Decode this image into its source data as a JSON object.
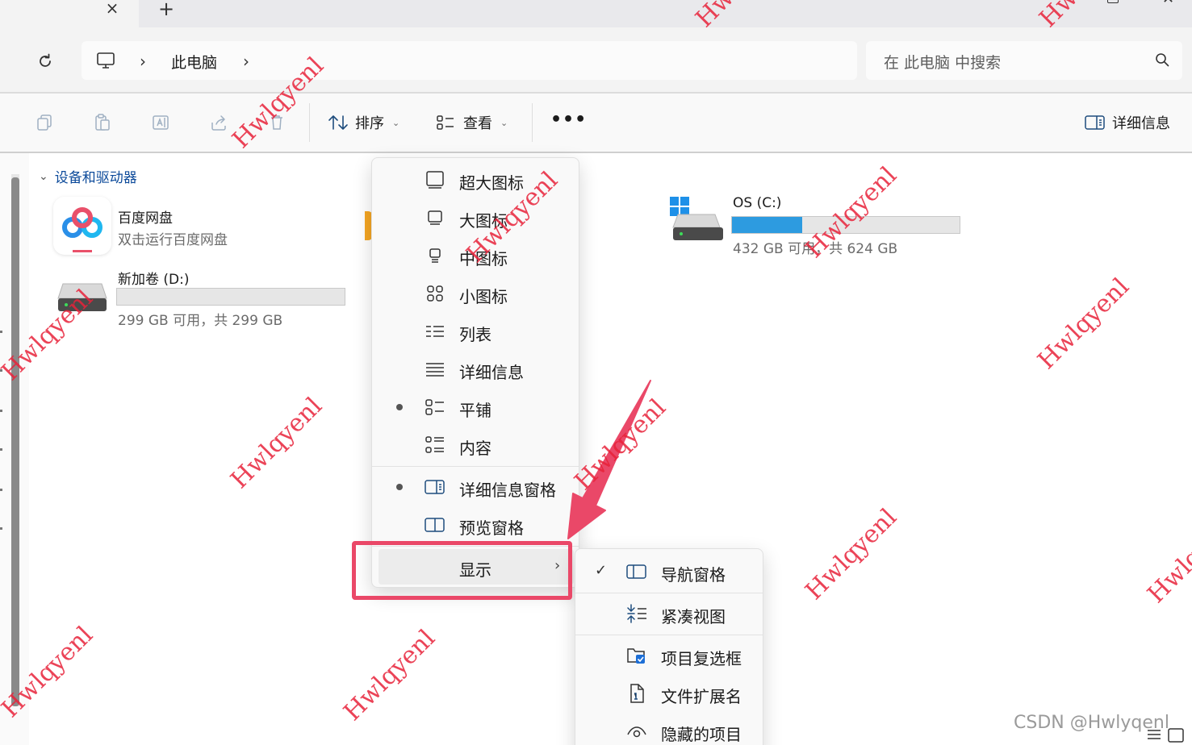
{
  "tabbar": {
    "close_glyph": "×",
    "add_glyph": "+"
  },
  "address": {
    "crumbs": [
      "此电脑"
    ],
    "search_placeholder": "在 此电脑 中搜索"
  },
  "toolbar": {
    "sort_label": "排序",
    "view_label": "查看",
    "more_label": "•••",
    "details_label": "详细信息"
  },
  "content": {
    "section_title": "设备和驱动器",
    "drives": [
      {
        "name": "百度网盘",
        "subtitle": "双击运行百度网盘"
      },
      {
        "name": "新加卷 (D:)",
        "space": "299 GB 可用，共 299 GB",
        "used_fraction": 0.0
      },
      {
        "name": "OS (C:)",
        "space": "432 GB 可用，共 624 GB",
        "used_fraction": 0.31
      }
    ]
  },
  "view_menu": {
    "items": [
      {
        "label": "超大图标",
        "icon": "extra-large-icons-icon",
        "selected": false
      },
      {
        "label": "大图标",
        "icon": "large-icons-icon",
        "selected": false
      },
      {
        "label": "中图标",
        "icon": "medium-icons-icon",
        "selected": false
      },
      {
        "label": "小图标",
        "icon": "small-icons-icon",
        "selected": false
      },
      {
        "label": "列表",
        "icon": "list-icon",
        "selected": false
      },
      {
        "label": "详细信息",
        "icon": "details-icon",
        "selected": false
      },
      {
        "label": "平铺",
        "icon": "tiles-icon",
        "selected": true
      },
      {
        "label": "内容",
        "icon": "content-icon",
        "selected": false
      }
    ],
    "panes": [
      {
        "label": "详细信息窗格",
        "icon": "details-pane-icon",
        "selected": true
      },
      {
        "label": "预览窗格",
        "icon": "preview-pane-icon",
        "selected": false
      }
    ],
    "show_label": "显示",
    "show_chevron": "›"
  },
  "show_submenu": {
    "items": [
      {
        "label": "导航窗格",
        "icon": "navigation-pane-icon",
        "checked": true
      },
      {
        "label": "紧凑视图",
        "icon": "compact-view-icon",
        "checked": false
      },
      {
        "label": "项目复选框",
        "icon": "item-checkboxes-icon",
        "checked": false
      },
      {
        "label": "文件扩展名",
        "icon": "file-extensions-icon",
        "checked": false
      },
      {
        "label": "隐藏的项目",
        "icon": "hidden-items-icon",
        "checked": false
      }
    ],
    "check_glyph": "✓"
  },
  "overlay": {
    "watermark_text": "Hwlqyenl",
    "credit": "CSDN @Hwlyqenl",
    "highlight_color": "#ea4868",
    "watermark_color": "#e8223a"
  },
  "colors": {
    "accent": "#2d9be0",
    "link": "#0c4a9a"
  }
}
